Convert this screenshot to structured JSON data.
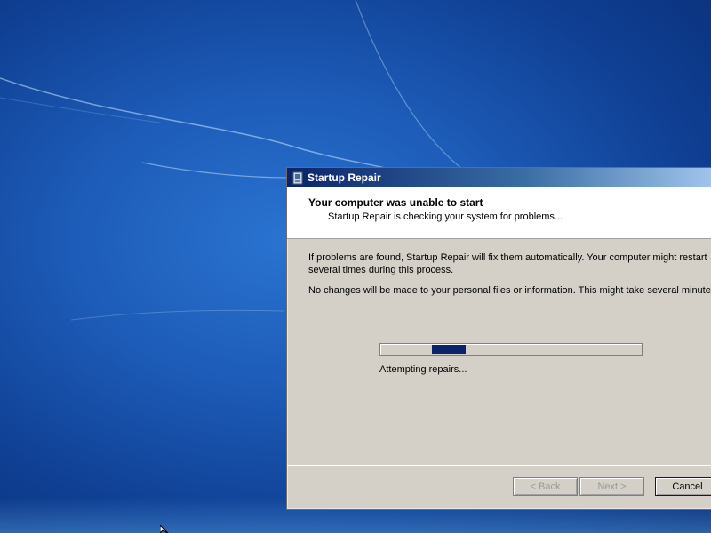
{
  "window": {
    "title": "Startup Repair",
    "icon": "startup-repair-icon"
  },
  "header": {
    "title": "Your computer was unable to start",
    "subtitle": "Startup Repair is checking your system for problems..."
  },
  "body": {
    "paragraph1_line1": "If problems are found, Startup Repair will fix them automatically. Your computer might restart",
    "paragraph1_line2": "several times during this process.",
    "paragraph2": "No changes will be made to your personal files or information. This might take several minutes."
  },
  "progress": {
    "style": "marquee",
    "status": "Attempting repairs..."
  },
  "buttons": {
    "back": "< Back",
    "next": "Next >",
    "cancel": "Cancel"
  },
  "colors": {
    "desktop_blue": "#1d5cb8",
    "titlebar_start": "#0a246a",
    "titlebar_end": "#a6caf0",
    "progress_fill": "#0a246a",
    "dialog_face": "#d4d0c8"
  }
}
